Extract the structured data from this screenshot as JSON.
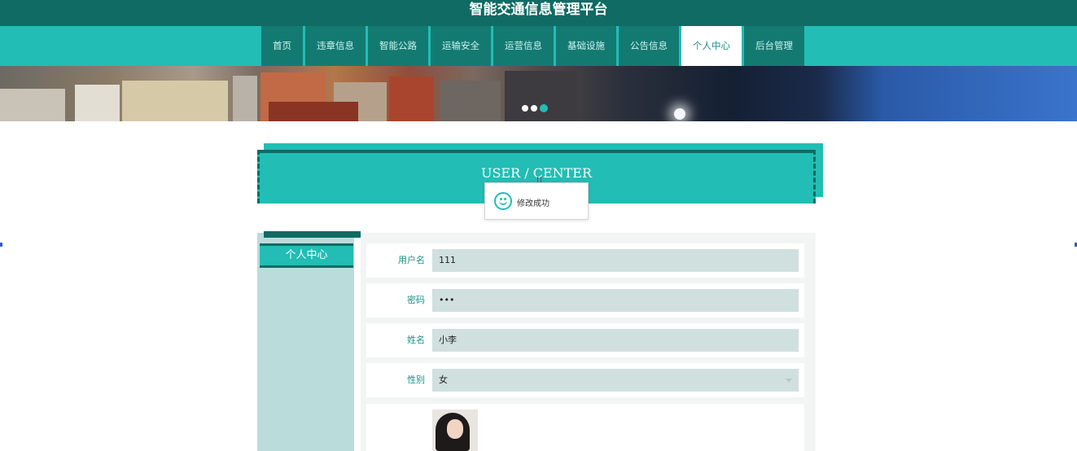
{
  "header": {
    "site_title": "智能交通信息管理平台"
  },
  "nav": {
    "items": [
      {
        "label": "首页",
        "active": false
      },
      {
        "label": "违章信息",
        "active": false
      },
      {
        "label": "智能公路",
        "active": false
      },
      {
        "label": "运输安全",
        "active": false
      },
      {
        "label": "运营信息",
        "active": false
      },
      {
        "label": "基础设施",
        "active": false
      },
      {
        "label": "公告信息",
        "active": false
      },
      {
        "label": "个人中心",
        "active": true
      },
      {
        "label": "后台管理",
        "active": false
      }
    ]
  },
  "banner": {
    "slide_count": 3,
    "active_slide": 3
  },
  "section": {
    "title": "USER / CENTER"
  },
  "toast": {
    "message": "修改成功",
    "icon": "smiley-icon"
  },
  "sidebar": {
    "heading": "个人中心"
  },
  "form": {
    "fields": [
      {
        "label": "用户名",
        "value": "111"
      },
      {
        "label": "密码",
        "value": "•••"
      },
      {
        "label": "姓名",
        "value": "小李"
      },
      {
        "label": "性别",
        "value": "女"
      }
    ]
  },
  "colors": {
    "primary": "#22bdb4",
    "dark": "#0f6b63",
    "input_bg": "#d0e0de",
    "sidebar_bg": "#badcda"
  }
}
